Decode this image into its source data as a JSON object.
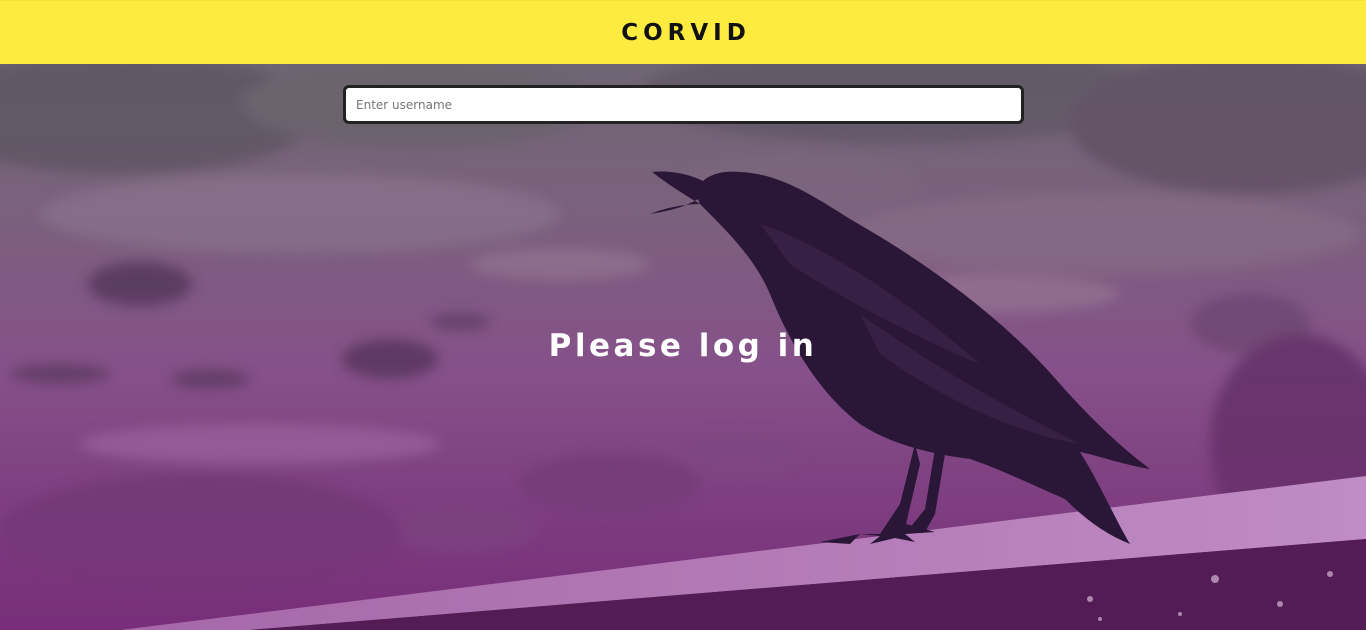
{
  "header": {
    "brand": "CORVID",
    "background_color": "#fdeb3f"
  },
  "login": {
    "username_placeholder": "Enter username",
    "username_value": "",
    "heading": "Please log in"
  },
  "background": {
    "description_icon": "crow-on-ledge-photo",
    "overlay_color": "#8a2c8a"
  }
}
